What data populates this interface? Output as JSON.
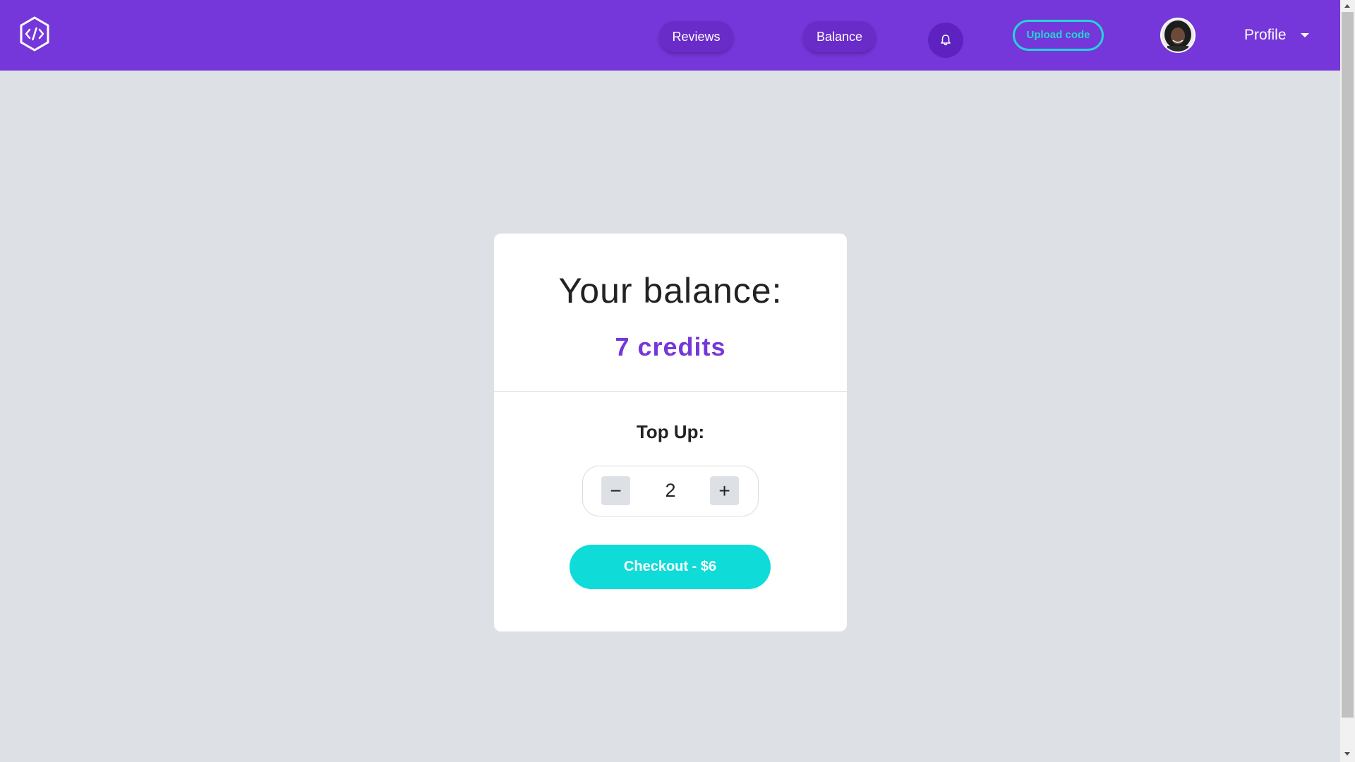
{
  "header": {
    "logo_icon": "code-hexagon-icon",
    "nav": {
      "reviews_label": "Reviews",
      "balance_label": "Balance"
    },
    "notifications_icon": "bell-icon",
    "upload_label": "Upload code",
    "profile_label": "Profile",
    "profile_caret_icon": "caret-down-icon"
  },
  "card": {
    "title": "Your balance:",
    "balance": "7 credits",
    "topup_label": "Top Up:",
    "stepper": {
      "minus_label": "−",
      "value": "2",
      "plus_label": "+"
    },
    "checkout_label": "Checkout - $6"
  },
  "colors": {
    "brand_purple": "#7537d9",
    "accent_cyan": "#0fdcd8",
    "page_bg": "#dde1e6"
  }
}
